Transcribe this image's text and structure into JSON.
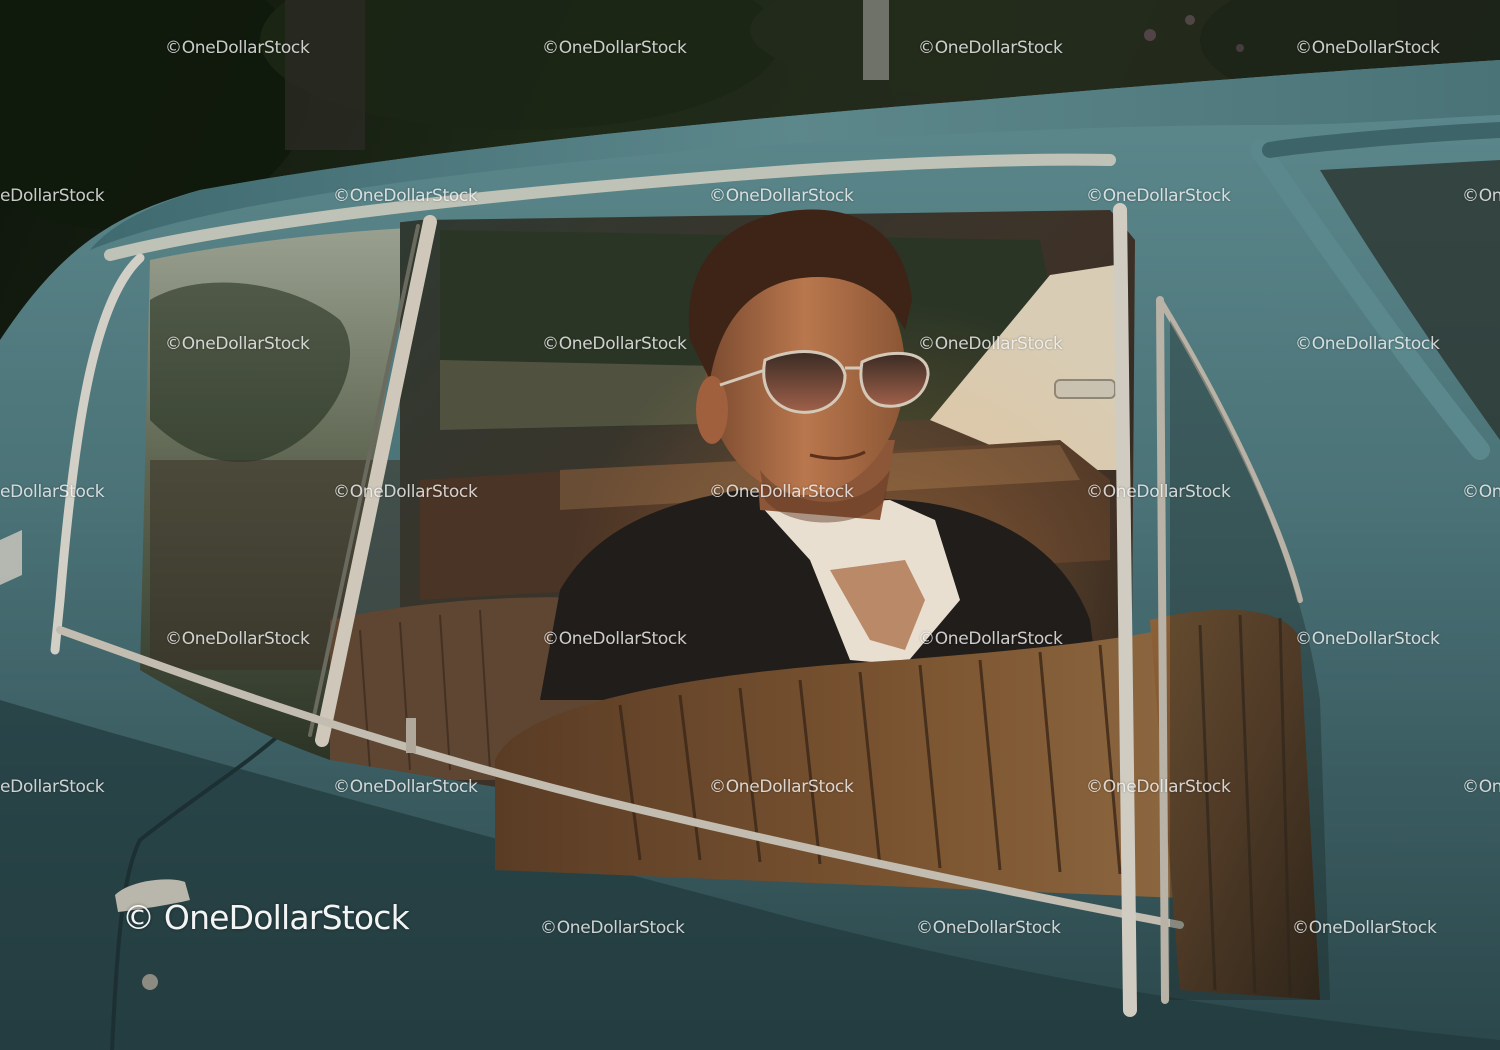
{
  "photo": {
    "subject": "man-in-vintage-car",
    "colors": {
      "car_body": "#4c7479",
      "car_body_dark": "#2a4549",
      "upholstery": "#7a5233",
      "upholstery_dark": "#3d2819",
      "foliage": "#14200f",
      "chrome": "#c9c4b8",
      "suit": "#24201d",
      "shirt": "#e7dccd",
      "skin": "#b0704a"
    }
  },
  "watermark": {
    "main": "© OneDollarStock",
    "tile": "©OneDollarStock",
    "tile_partial": "eDollarStock"
  }
}
